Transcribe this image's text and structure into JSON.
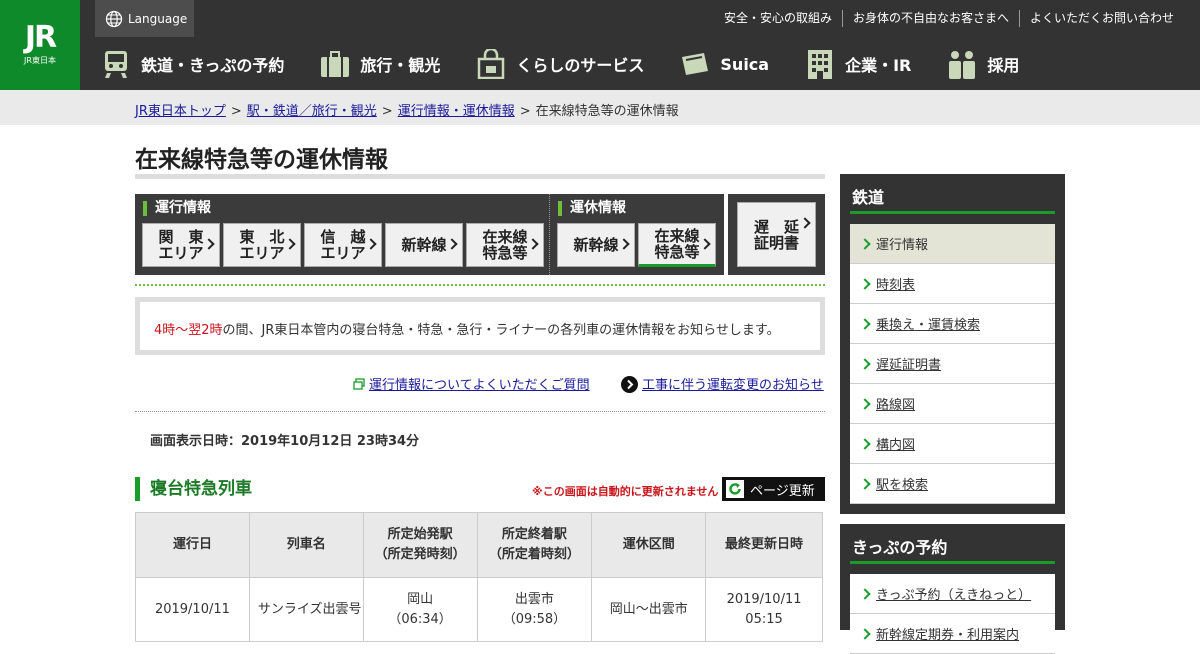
{
  "header": {
    "logo_mark": "JR",
    "logo_sub": "JR東日本",
    "language": "Language",
    "utility": [
      "安全・安心の取組み",
      "お身体の不自由なお客さまへ",
      "よくいただくお問い合わせ"
    ],
    "nav": [
      {
        "label": "鉄道・きっぷの予約",
        "icon": "train-icon"
      },
      {
        "label": "旅行・観光",
        "icon": "suitcase-icon"
      },
      {
        "label": "くらしのサービス",
        "icon": "shopping-bag-icon"
      },
      {
        "label": "Suica",
        "icon": "suica-card-icon"
      },
      {
        "label": "企業・IR",
        "icon": "building-icon"
      },
      {
        "label": "採用",
        "icon": "people-icon"
      }
    ]
  },
  "breadcrumb": {
    "items": [
      "JR東日本トップ",
      "駅・鉄道／旅行・観光",
      "運行情報・運休情報"
    ],
    "current": "在来線特急等の運休情報",
    "sep": ">"
  },
  "main": {
    "title": "在来線特急等の運休情報",
    "tabs": {
      "operation_label": "運行情報",
      "suspension_label": "運休情報",
      "operation": [
        {
          "line1": "関　東",
          "line2": "エリア"
        },
        {
          "line1": "東　北",
          "line2": "エリア"
        },
        {
          "line1": "信　越",
          "line2": "エリア"
        },
        {
          "line1": "新幹線",
          "line2": ""
        },
        {
          "line1": "在来線",
          "line2": "特急等"
        }
      ],
      "suspension": [
        {
          "line1": "新幹線",
          "line2": ""
        },
        {
          "line1": "在来線",
          "line2": "特急等"
        }
      ],
      "delay": {
        "line1": "遅　延",
        "line2": "証明書"
      }
    },
    "notice_red": "4時～翌2時",
    "notice_rest": "の間、JR東日本管内の寝台特急・特急・急行・ライナーの各列車の運休情報をお知らせします。",
    "faq_link": "運行情報についてよくいただくご質問",
    "construction_link": "工事に伴う運転変更のお知らせ",
    "timestamp": "画面表示日時：2019年10月12日 23時34分",
    "section_title": "寝台特急列車",
    "auto_note": "※この画面は自動的に更新されません",
    "refresh_label": "ページ更新",
    "table": {
      "headers": [
        "運行日",
        "列車名",
        "所定始発駅\n（所定発時刻）",
        "所定終着駅\n（所定着時刻）",
        "運休区間",
        "最終更新日時"
      ],
      "rows": [
        {
          "date": "2019/10/11",
          "name": "サンライズ出雲号",
          "from": "岡山",
          "from_time": "（06:34）",
          "to": "出雲市",
          "to_time": "（09:58）",
          "section": "岡山～出雲市",
          "updated_date": "2019/10/11",
          "updated_time": "05:15"
        }
      ]
    }
  },
  "sidebar": {
    "rail_title": "鉄道",
    "rail_items": [
      "運行情報",
      "時刻表",
      "乗換え・運賃検索",
      "遅延証明書",
      "路線図",
      "構内図",
      "駅を検索"
    ],
    "ticket_title": "きっぷの予約",
    "ticket_items": [
      "きっぷ予約（えきねっと）",
      "新幹線定期券・利用案内"
    ]
  },
  "colors": {
    "brand_green": "#0f8a2b",
    "accent_green": "#1a9c2b",
    "notice_red": "#c9141a",
    "header_bg": "#333333"
  }
}
